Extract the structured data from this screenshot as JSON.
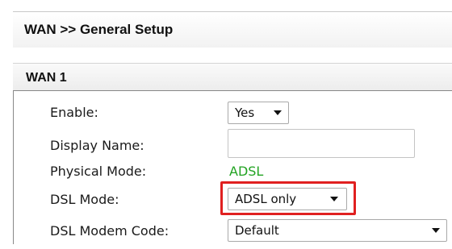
{
  "breadcrumb": "WAN >> General Setup",
  "section": {
    "title": "WAN 1"
  },
  "fields": {
    "enable": {
      "label": "Enable:",
      "value": "Yes"
    },
    "display_name": {
      "label": "Display Name:",
      "value": ""
    },
    "physical_mode": {
      "label": "Physical Mode:",
      "value": "ADSL"
    },
    "dsl_mode": {
      "label": "DSL Mode:",
      "value": "ADSL only"
    },
    "dsl_modem_code": {
      "label": "DSL Modem Code:",
      "value": "Default"
    }
  },
  "colors": {
    "physical_mode_value": "#22a322",
    "highlight_border": "#e02020"
  }
}
